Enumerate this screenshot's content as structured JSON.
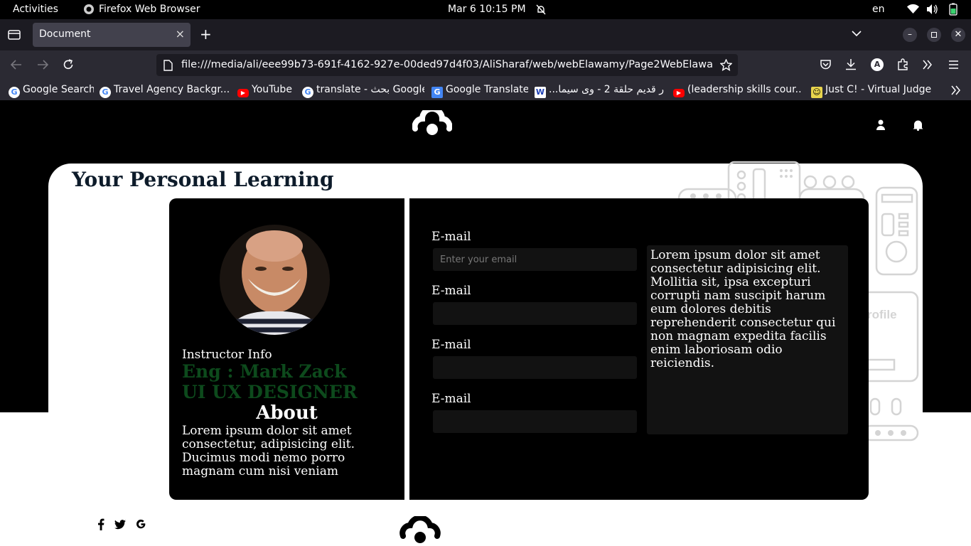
{
  "system_bar": {
    "activities": "Activities",
    "app_name": "Firefox Web Browser",
    "datetime": "Mar 6  10:15 PM",
    "lang": "en"
  },
  "browser": {
    "tab_title": "Document",
    "url": "file:///media/ali/eee99b73-691f-4162-927e-00ded97d4f03/AliSharaf/web/webElawamy/Page2WebElawamy/",
    "bookmarks": [
      {
        "label": "Google Search",
        "icon": "google-icon"
      },
      {
        "label": "Travel Agency Backgr...",
        "icon": "google-icon"
      },
      {
        "label": "YouTube",
        "icon": "youtube-icon"
      },
      {
        "label": "translate - بحث Google",
        "icon": "google-icon"
      },
      {
        "label": "Google Translate",
        "icon": "google-translate-icon"
      },
      {
        "label": "...ر قديم حلقة 2 - وى سيما",
        "icon": "w-icon"
      },
      {
        "label": "(leadership skills cour...",
        "icon": "youtube-icon"
      },
      {
        "label": "Just C! - Virtual Judge",
        "icon": "judge-icon"
      }
    ]
  },
  "page": {
    "heading": "Your Personal Learning",
    "illustration_text": "rofile",
    "instructor": {
      "label": "Instructor Info",
      "name": "Eng : Mark Zack",
      "role": "UI UX DESIGNER",
      "about_title": "About",
      "about_text": "Lorem ipsum dolor sit amet consectetur, adipisicing elit. Ducimus modi nemo porro magnam cum nisi veniam"
    },
    "form": {
      "fields": [
        {
          "label": "E-mail",
          "placeholder": "Enter your email"
        },
        {
          "label": "E-mail",
          "placeholder": ""
        },
        {
          "label": "E-mail",
          "placeholder": ""
        },
        {
          "label": "E-mail",
          "placeholder": ""
        }
      ],
      "note": "Lorem ipsum dolor sit amet consectetur adipisicing elit. Mollitia sit, ipsa excepturi corrupti nam suscipit harum eum dolores debitis reprehenderit consectetur qui non magnam expedita facilis enim laboriosam odio reiciendis."
    }
  }
}
